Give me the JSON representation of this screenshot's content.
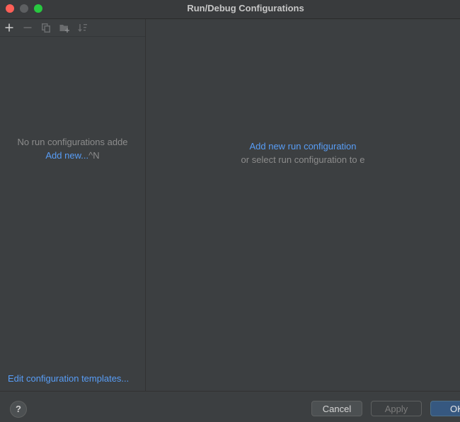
{
  "window": {
    "title": "Run/Debug Configurations"
  },
  "toolbar": {
    "icons": [
      "plus-icon",
      "minus-icon",
      "copy-icon",
      "folder-add-icon",
      "sort-icon"
    ]
  },
  "left_panel": {
    "empty_message": "No run configurations adde",
    "add_new_label": "Add new...",
    "add_new_shortcut": "^N",
    "templates_link": "Edit configuration templates..."
  },
  "right_panel": {
    "add_link": "Add new run configuration",
    "hint": "or select run configuration to e"
  },
  "footer": {
    "help_label": "?",
    "cancel_label": "Cancel",
    "apply_label": "Apply",
    "ok_label": "OK"
  },
  "colors": {
    "background": "#3c3f41",
    "link": "#589df6",
    "muted_text": "#8c8c8c",
    "primary_button": "#365880",
    "close_button": "#ff5f57",
    "zoom_button": "#28c840"
  }
}
